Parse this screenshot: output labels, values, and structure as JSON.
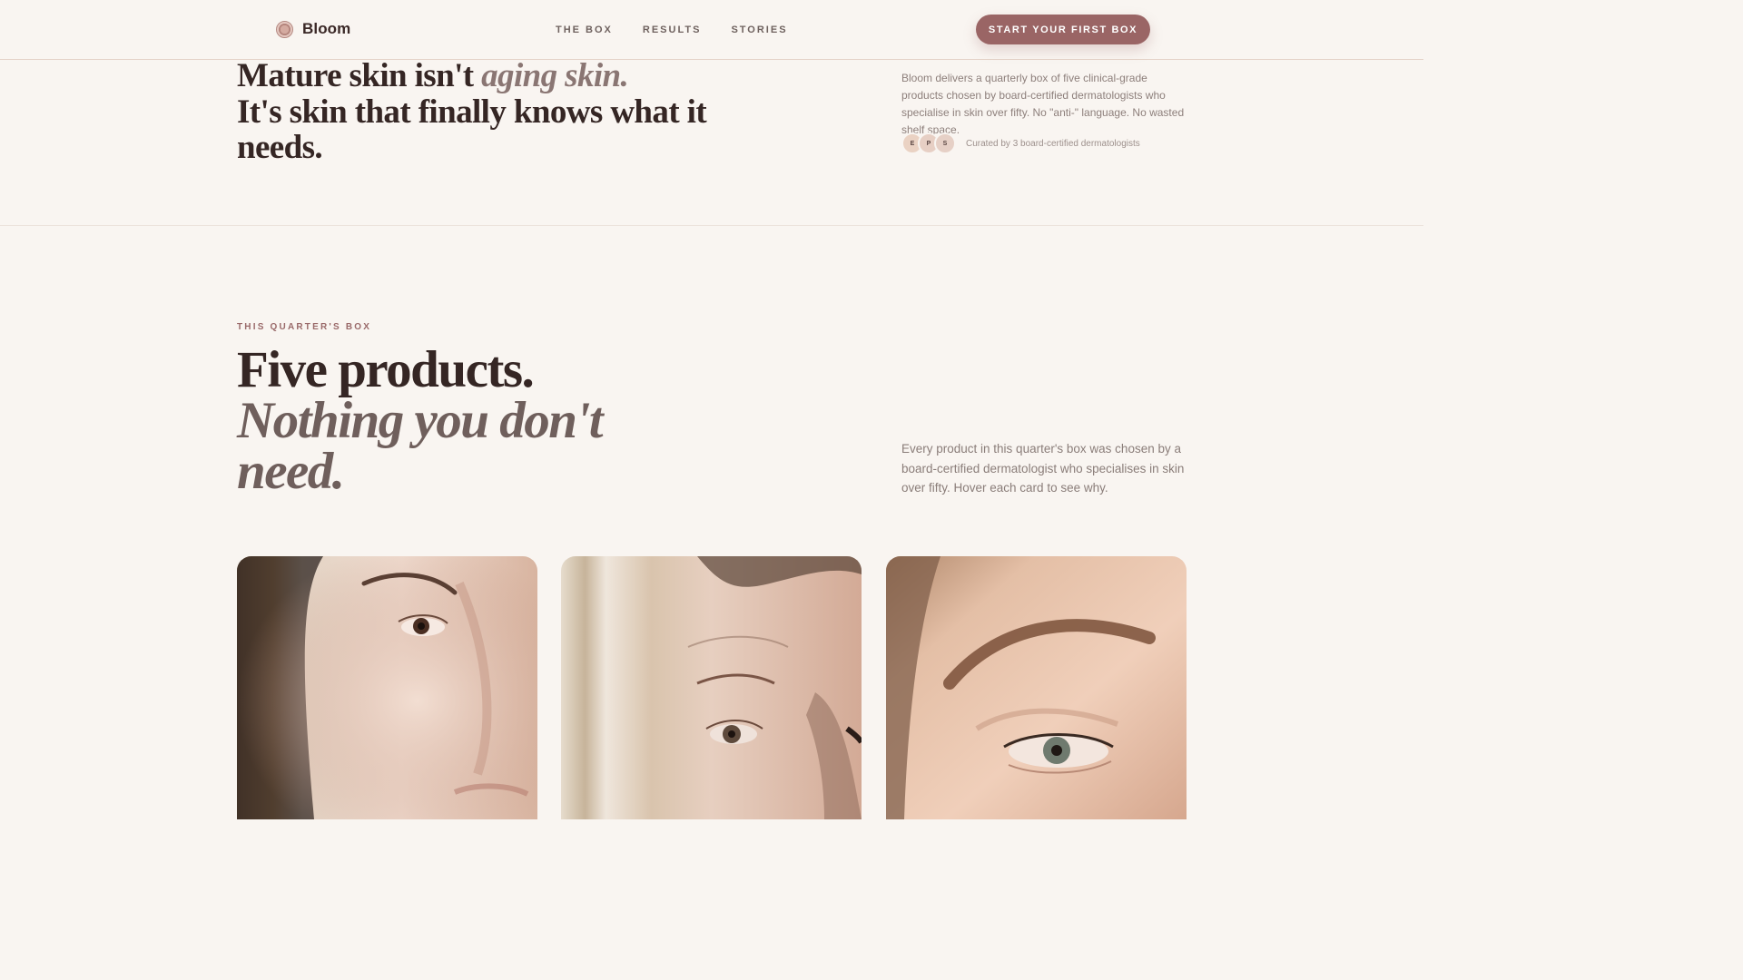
{
  "brand": {
    "name": "Bloom",
    "logo_icon": "bloom-logo-icon"
  },
  "nav": {
    "items": [
      "THE BOX",
      "RESULTS",
      "STORIES"
    ]
  },
  "header": {
    "cta_label": "START YOUR FIRST BOX",
    "accent_color": "#9a6565"
  },
  "hero": {
    "title_part1": "Mature skin isn't ",
    "title_emphasis": "aging skin.",
    "title_part2": "It's skin that finally knows what it needs.",
    "description": "Bloom delivers a quarterly box of five clinical-grade products chosen by board-certified dermatologists who specialise in skin over fifty. No \"anti-\" language. No wasted shelf space.",
    "curators": {
      "avatars": [
        "E",
        "P",
        "S"
      ],
      "text": "Curated by 3 board-certified dermatologists"
    }
  },
  "box_section": {
    "eyebrow": "THIS QUARTER'S BOX",
    "title_line1": "Five products.",
    "title_emphasis": "Nothing you don't need.",
    "description": "Every product in this quarter's box was chosen by a board-certified dermatologist who specialises in skin over fifty. Hover each card to see why."
  },
  "cards": [
    {
      "image": "woman-face-closeup-photo"
    },
    {
      "image": "woman-eye-closeup-photo"
    },
    {
      "image": "eye-closeup-photo"
    }
  ]
}
